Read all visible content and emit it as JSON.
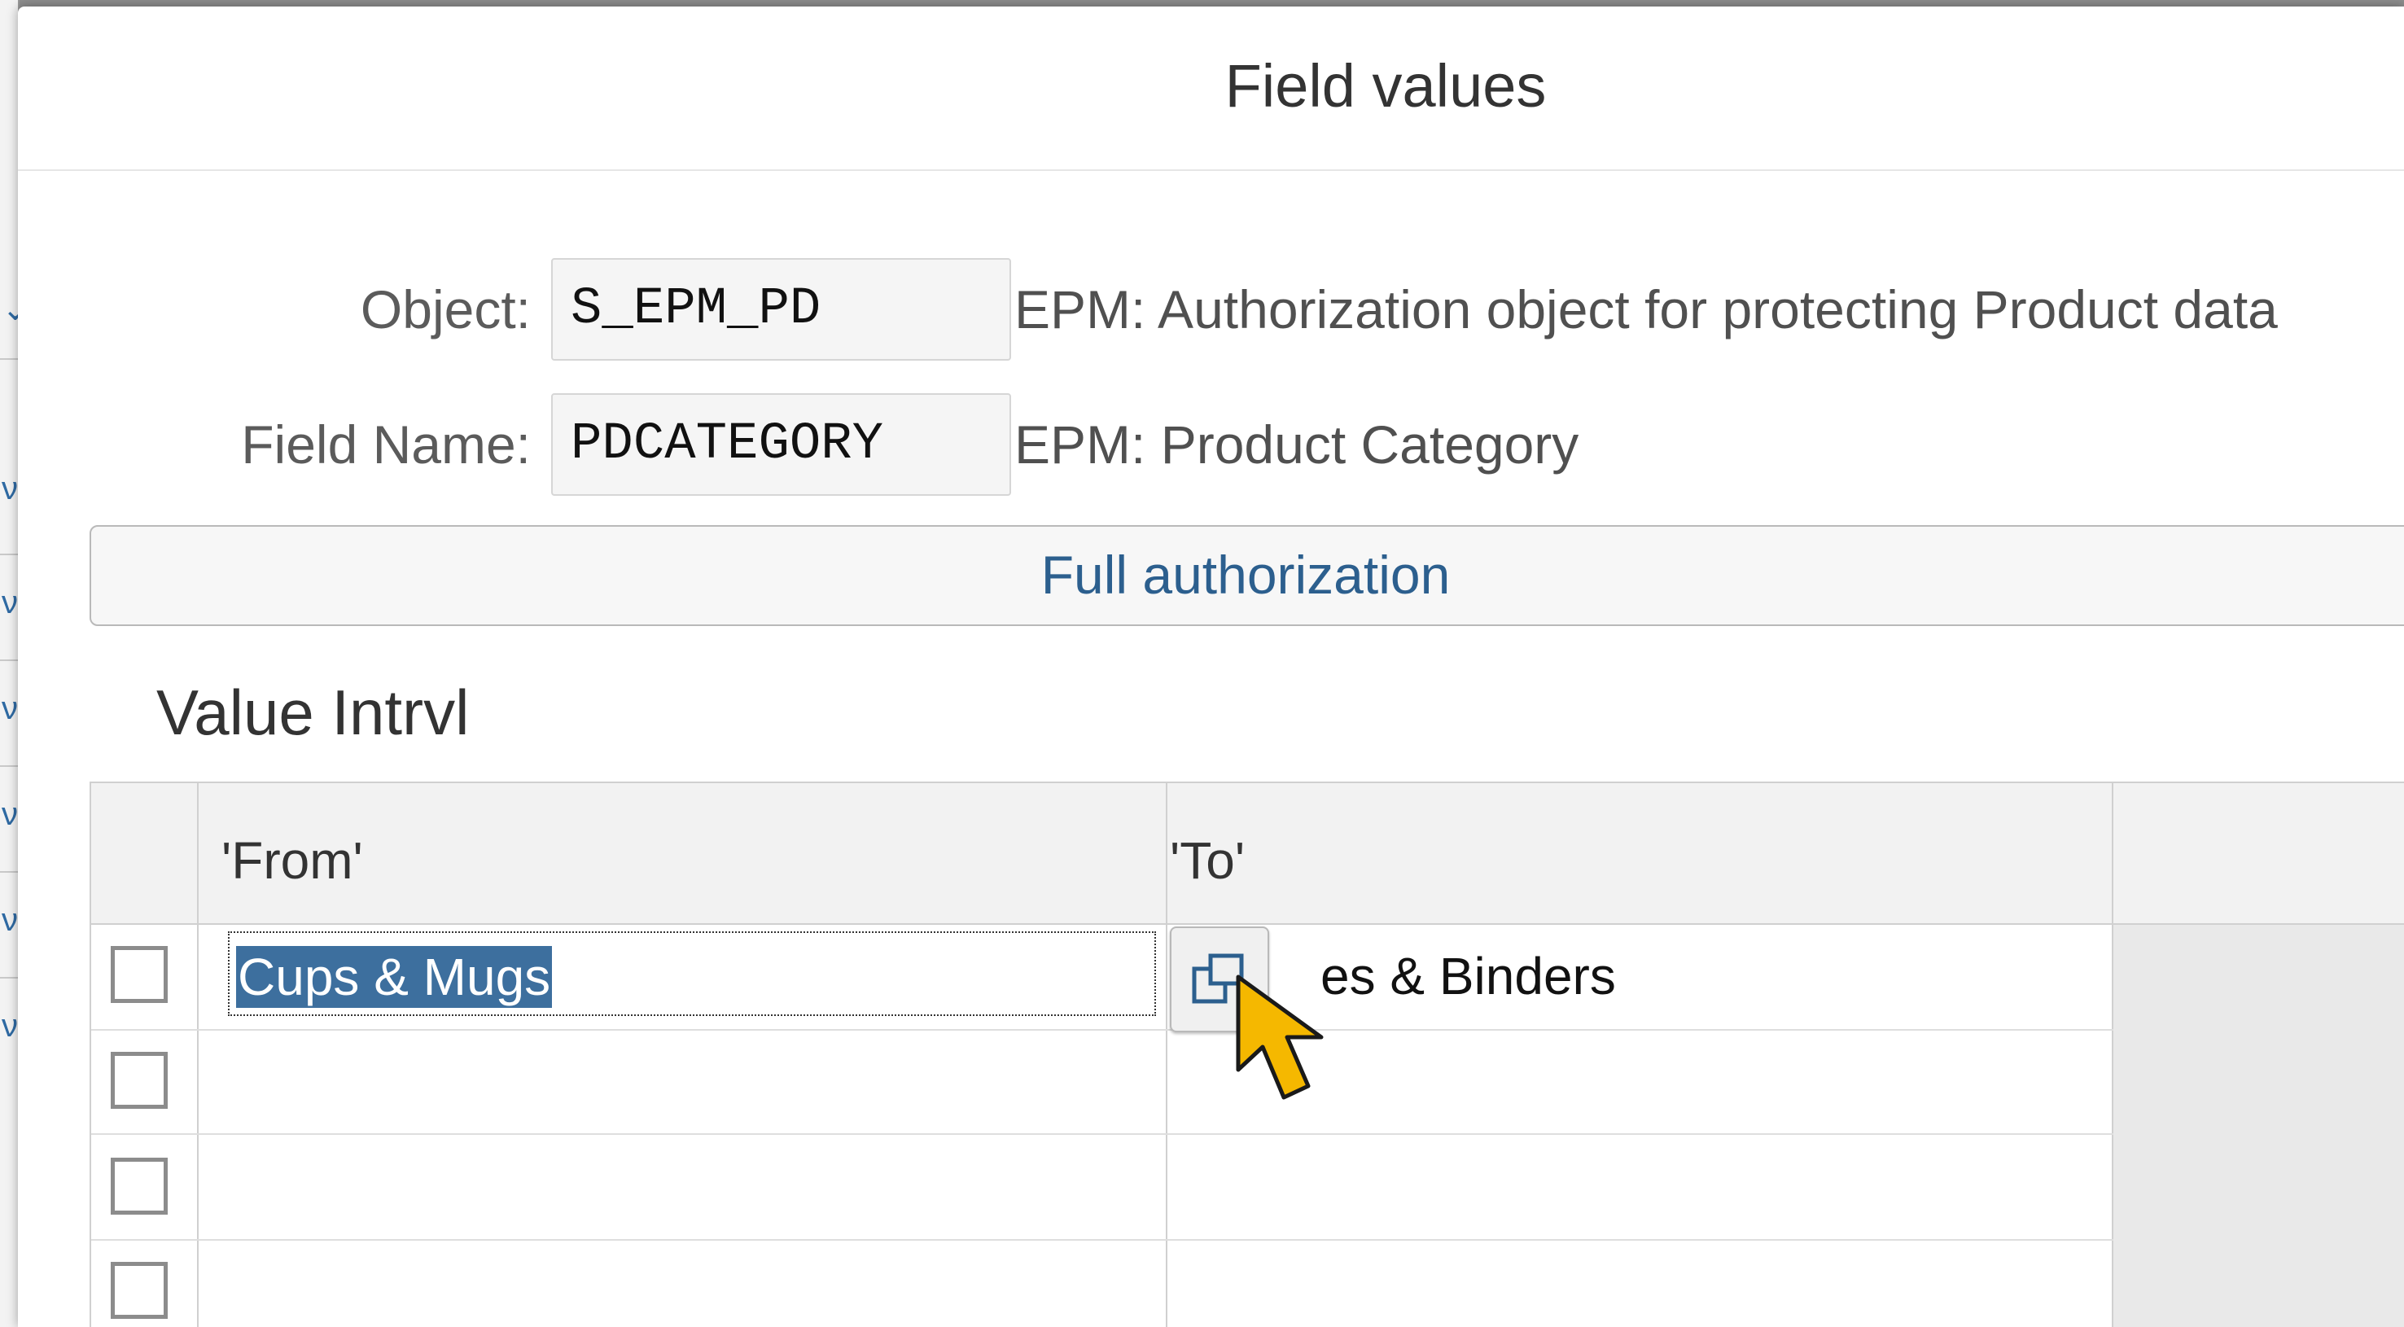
{
  "dialog": {
    "title": "Field values"
  },
  "fields": [
    {
      "label": "Object:",
      "value": "S_EPM_PD",
      "description": "EPM: Authorization object for protecting Product data"
    },
    {
      "label": "Field Name:",
      "value": "PDCATEGORY",
      "description": "EPM: Product Category"
    }
  ],
  "full_authorization_label": "Full authorization",
  "section_title": "Value Intrvl",
  "table": {
    "columns": [
      "'From'",
      "'To'"
    ],
    "rows": [
      {
        "from": "Cups & Mugs",
        "to": "es & Binders",
        "selected": false
      },
      {
        "from": "",
        "to": "",
        "selected": false
      },
      {
        "from": "",
        "to": "",
        "selected": false
      },
      {
        "from": "",
        "to": "",
        "selected": false
      }
    ]
  },
  "icons": {
    "value_help": "value-help-icon",
    "cursor": "mouse-pointer-icon"
  },
  "colors": {
    "accent": "#2c5f8e",
    "selection": "#3d6f9e",
    "cursor": "#f5b800"
  }
}
